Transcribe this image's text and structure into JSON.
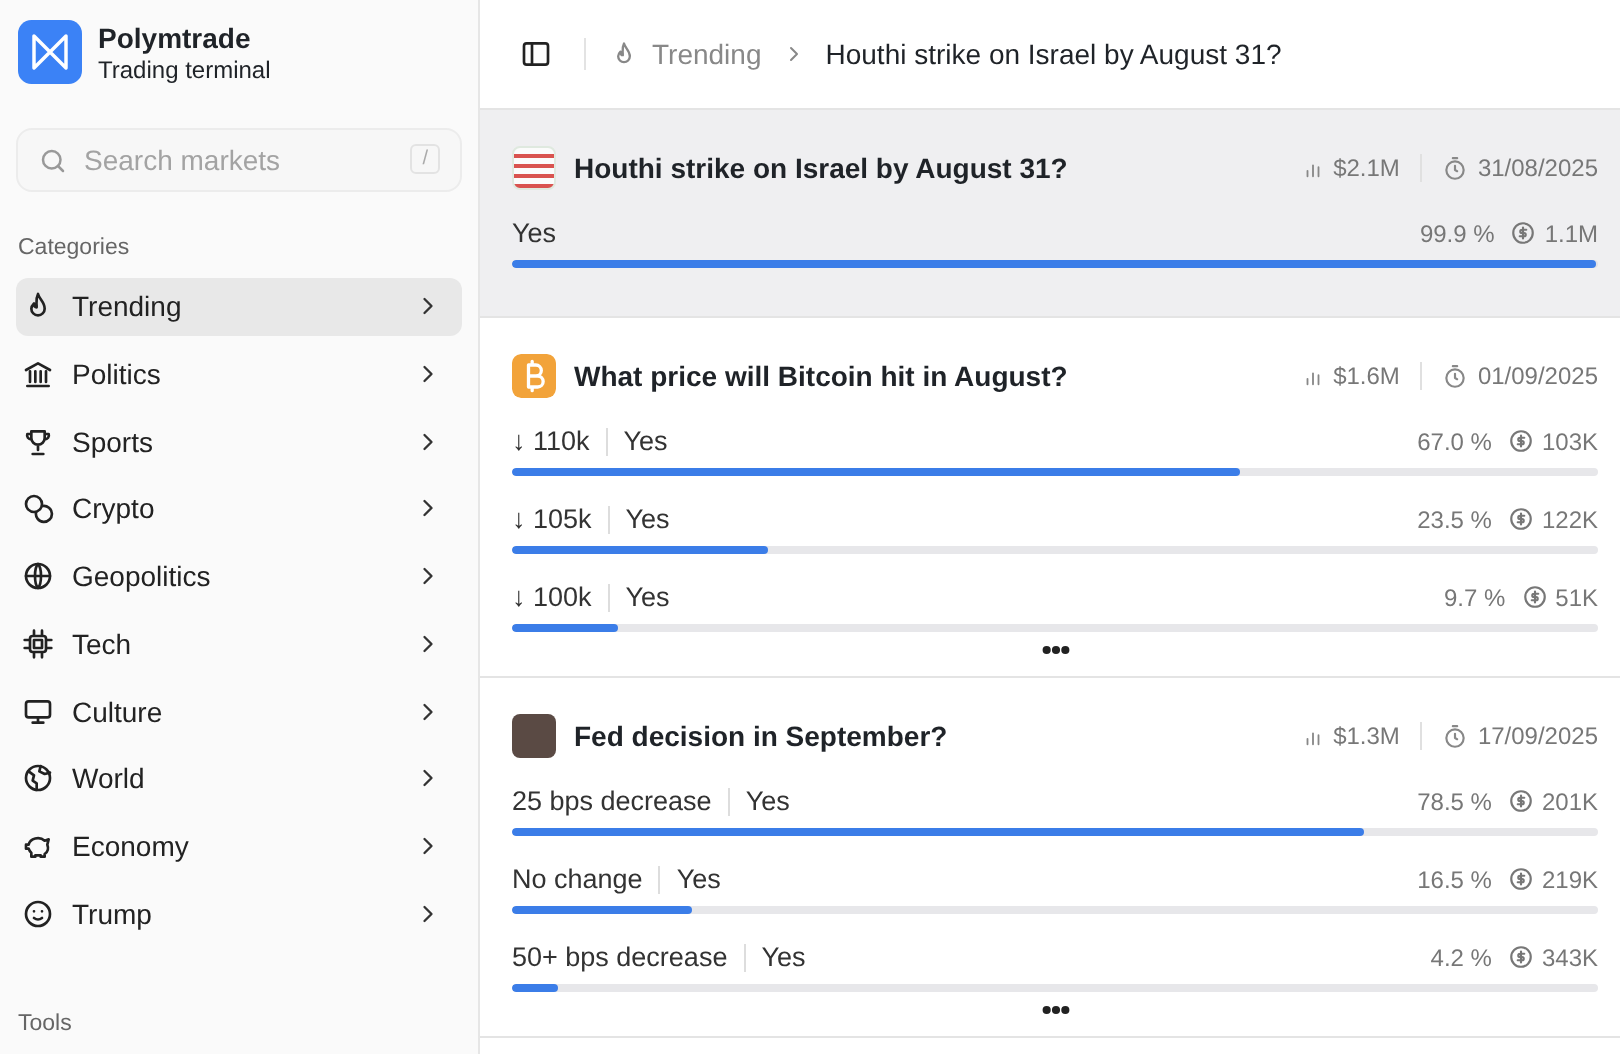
{
  "app": {
    "name": "Polymtrade",
    "subtitle": "Trading terminal"
  },
  "search": {
    "placeholder": "Search markets",
    "shortcut": "/"
  },
  "sidebar": {
    "section_title": "Categories",
    "items": [
      {
        "label": "Trending",
        "selected": true
      },
      {
        "label": "Politics",
        "selected": false
      },
      {
        "label": "Sports",
        "selected": false
      },
      {
        "label": "Crypto",
        "selected": false
      },
      {
        "label": "Geopolitics",
        "selected": false
      },
      {
        "label": "Tech",
        "selected": false
      },
      {
        "label": "Culture",
        "selected": false
      },
      {
        "label": "World",
        "selected": false
      },
      {
        "label": "Economy",
        "selected": false
      },
      {
        "label": "Trump",
        "selected": false
      }
    ],
    "next_section_title": "Tools"
  },
  "breadcrumb": {
    "parent": "Trending",
    "current": "Houthi strike on Israel by August 31?"
  },
  "markets": [
    {
      "title": "Houthi strike on Israel by August 31?",
      "selected": true,
      "volume": "$2.1M",
      "end_date": "31/08/2025",
      "more": false,
      "outcomes": [
        {
          "label": "Yes",
          "percent": "99.9 %",
          "level": 0.999,
          "amount": "1.1M"
        }
      ]
    },
    {
      "title": "What price will Bitcoin hit in August?",
      "selected": false,
      "volume": "$1.6M",
      "end_date": "01/09/2025",
      "more": true,
      "outcomes": [
        {
          "label": "↓ 110k",
          "side": "Yes",
          "percent": "67.0 %",
          "level": 0.67,
          "amount": "103K"
        },
        {
          "label": "↓ 105k",
          "side": "Yes",
          "percent": "23.5 %",
          "level": 0.235,
          "amount": "122K"
        },
        {
          "label": "↓ 100k",
          "side": "Yes",
          "percent": "9.7 %",
          "level": 0.097,
          "amount": "51K"
        }
      ]
    },
    {
      "title": "Fed decision in September?",
      "selected": false,
      "volume": "$1.3M",
      "end_date": "17/09/2025",
      "more": true,
      "outcomes": [
        {
          "label": "25 bps decrease",
          "side": "Yes",
          "percent": "78.5 %",
          "level": 0.785,
          "amount": "201K"
        },
        {
          "label": "No change",
          "side": "Yes",
          "percent": "16.5 %",
          "level": 0.165,
          "amount": "219K"
        },
        {
          "label": "50+ bps decrease",
          "side": "Yes",
          "percent": "4.2 %",
          "level": 0.042,
          "amount": "343K"
        }
      ]
    }
  ]
}
